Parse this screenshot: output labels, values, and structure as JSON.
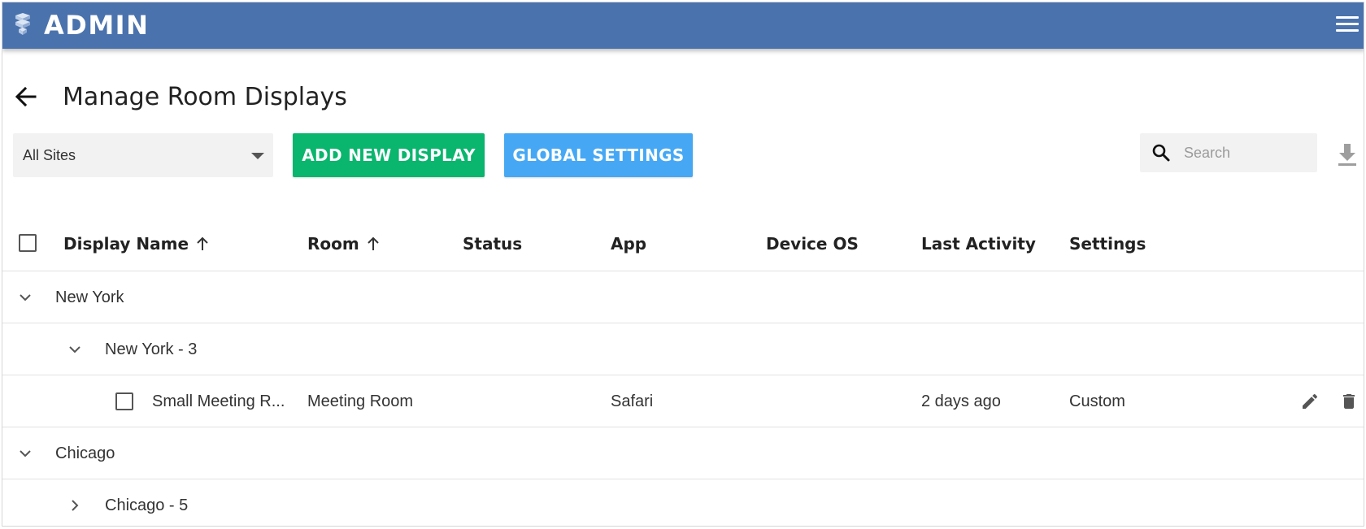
{
  "header": {
    "brand": "ADMIN",
    "logo_icon": "cube-stack-logo",
    "menu_icon": "hamburger-menu-icon",
    "background_color": "#4a72ad"
  },
  "page": {
    "title": "Manage Room Displays",
    "back_icon": "arrow-left-icon"
  },
  "toolbar": {
    "site_filter": {
      "selected": "All Sites"
    },
    "add_display_label": "ADD NEW DISPLAY",
    "global_settings_label": "GLOBAL SETTINGS",
    "search_placeholder": "Search",
    "add_color": "#0ab56e",
    "global_color": "#46a8f4"
  },
  "table": {
    "columns": [
      {
        "key": "display_name",
        "label": "Display Name",
        "sort": "asc"
      },
      {
        "key": "room",
        "label": "Room",
        "sort": "asc"
      },
      {
        "key": "status",
        "label": "Status"
      },
      {
        "key": "app",
        "label": "App"
      },
      {
        "key": "device_os",
        "label": "Device OS"
      },
      {
        "key": "last_activity",
        "label": "Last Activity"
      },
      {
        "key": "settings",
        "label": "Settings"
      }
    ],
    "groups": [
      {
        "label": "New York",
        "expanded": true,
        "subgroups": [
          {
            "label": "New York - 3",
            "expanded": true,
            "rows": [
              {
                "display_name": "Small Meeting R...",
                "room": "Meeting Room",
                "status": "",
                "app": "Safari",
                "device_os": "",
                "last_activity": "2 days ago",
                "settings": "Custom"
              }
            ]
          }
        ]
      },
      {
        "label": "Chicago",
        "expanded": true,
        "subgroups": [
          {
            "label": "Chicago - 5",
            "expanded": false,
            "rows": []
          }
        ]
      }
    ]
  }
}
